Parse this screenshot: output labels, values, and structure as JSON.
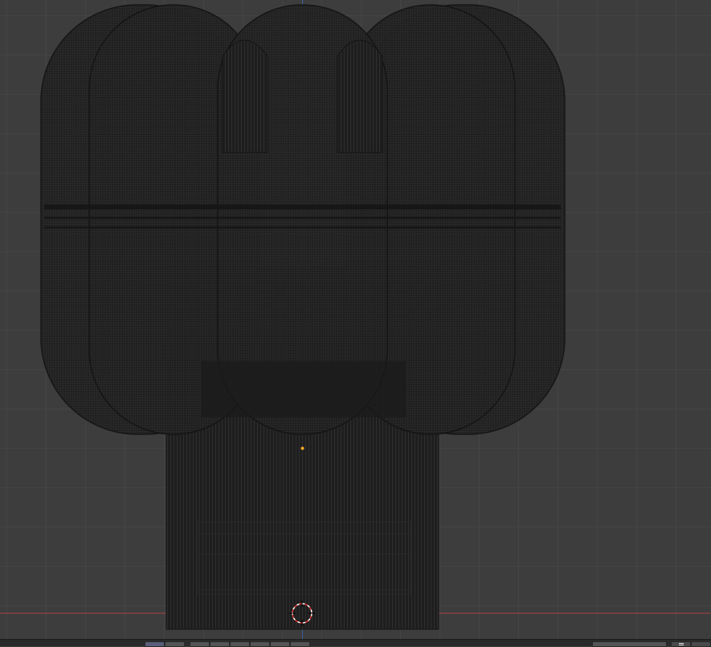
{
  "viewport": {
    "background": "#3d3d3d",
    "grid_color": "#4a4a4a",
    "x_axis_color": "#a84444",
    "y_axis_color": "#3a5fa0",
    "mesh_fill": "#1e1e1e",
    "mesh_line": "#141414",
    "origin_color": "#f5a623",
    "cursor_color": "#ffffff",
    "mode": "wireframe"
  },
  "statusbar": {
    "buttons": [
      {
        "name": "mode-button",
        "label": "",
        "active": true
      },
      {
        "name": "select-mode-button",
        "label": "",
        "active": false
      },
      {
        "name": "pivot-button",
        "label": "",
        "active": false
      },
      {
        "name": "snap-button",
        "label": "",
        "active": false
      },
      {
        "name": "proportional-button",
        "label": "",
        "active": false
      },
      {
        "name": "overlay-button",
        "label": "",
        "active": false
      },
      {
        "name": "shading-button",
        "label": "",
        "active": false
      },
      {
        "name": "xray-button",
        "label": "",
        "active": false
      }
    ],
    "right_field": {
      "label": "",
      "value": ""
    },
    "right_icon": "menu-icon"
  }
}
